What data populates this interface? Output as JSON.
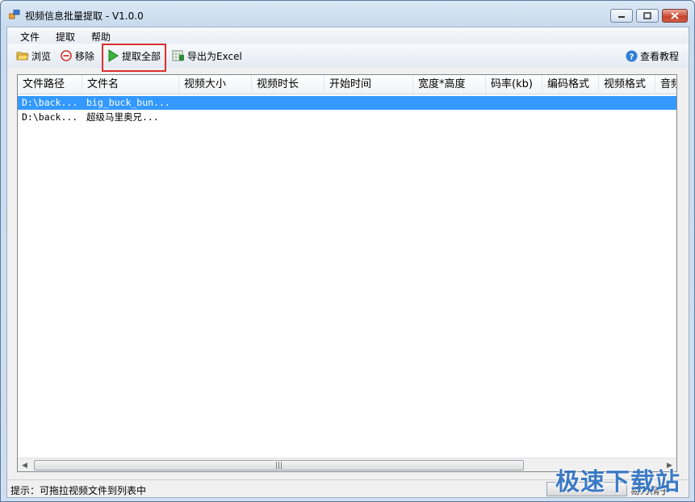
{
  "window": {
    "title": "视频信息批量提取 - V1.0.0"
  },
  "menu": {
    "items": [
      "文件",
      "提取",
      "帮助"
    ]
  },
  "toolbar": {
    "browse": "浏览",
    "remove": "移除",
    "extract_all": "提取全部",
    "export_excel": "导出为Excel",
    "tutorial": "查看教程"
  },
  "list": {
    "columns": [
      "文件路径",
      "文件名",
      "视频大小",
      "视频时长",
      "开始时间",
      "宽度*高度",
      "码率(kb)",
      "编码格式",
      "视频格式",
      "音频"
    ],
    "rows": [
      {
        "path": "D:\\back...",
        "name": "big_buck_bun...",
        "selected": true
      },
      {
        "path": "D:\\back...",
        "name": "超级马里奥兄...",
        "selected": false
      }
    ]
  },
  "status": {
    "hint": "提示：可拖拉视频文件到列表中",
    "button_text": "易为精子"
  },
  "watermark": "极速下载站",
  "colors": {
    "selection": "#3399ff",
    "highlight_box": "#d9302f",
    "watermark": "#2a6fc0"
  }
}
